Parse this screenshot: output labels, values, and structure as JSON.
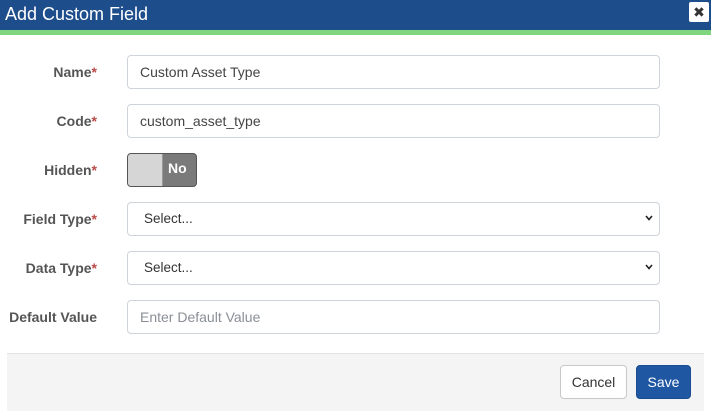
{
  "dialog": {
    "title": "Add Custom Field",
    "close_icon": "close-icon"
  },
  "form": {
    "required_mark": "*",
    "name": {
      "label": "Name",
      "value": "Custom Asset Type"
    },
    "code": {
      "label": "Code",
      "value": "custom_asset_type"
    },
    "hidden": {
      "label": "Hidden",
      "toggle_text": "No",
      "state": "off"
    },
    "field_type": {
      "label": "Field Type",
      "selected": "Select..."
    },
    "data_type": {
      "label": "Data Type",
      "selected": "Select..."
    },
    "default_value": {
      "label": "Default Value",
      "placeholder": "Enter Default Value",
      "value": ""
    }
  },
  "footer": {
    "cancel_label": "Cancel",
    "save_label": "Save"
  },
  "colors": {
    "header_bg": "#1e4d8c",
    "header_accent": "#7fd67f",
    "primary_button": "#1f57a3",
    "required_mark": "#b94a48"
  }
}
